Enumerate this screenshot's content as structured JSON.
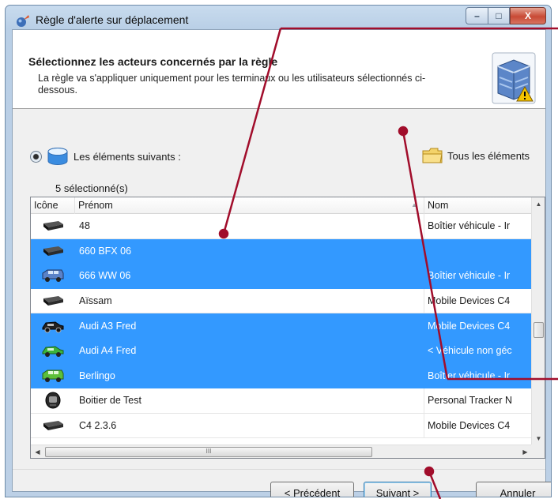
{
  "window": {
    "title": "Règle d'alerte sur déplacement",
    "controls": {
      "minimize": "–",
      "maximize": "□",
      "close": "X"
    }
  },
  "header": {
    "title": "Sélectionnez les acteurs concernés par la règle",
    "description": "La règle va s'appliquer uniquement pour les terminaux ou les utilisateurs sélectionnés ci-dessous.",
    "image_icon": "server-warning-icon"
  },
  "options": {
    "following": {
      "label": "Les éléments suivants :",
      "icon": "database-icon",
      "selected": true
    },
    "all": {
      "label": "Tous les éléments",
      "icon": "folder-icon",
      "selected": false
    }
  },
  "selected_count": "5 sélectionné(s)",
  "grid": {
    "columns": [
      "Icône",
      "Prénom",
      "Nom"
    ],
    "sort_indicator": "▲",
    "rows": [
      {
        "icon": "tracker-box-icon",
        "prenom": "48",
        "nom": "Boîtier véhicule - Ir",
        "selected": false
      },
      {
        "icon": "tracker-box-icon",
        "prenom": "660 BFX 06",
        "nom": "",
        "selected": true
      },
      {
        "icon": "van-icon",
        "prenom": "666 WW 06",
        "nom": "Boîtier véhicule - Ir",
        "selected": true
      },
      {
        "icon": "tracker-box-icon",
        "prenom": "Aïssam",
        "nom": "Mobile Devices C4",
        "selected": false
      },
      {
        "icon": "car-icon",
        "prenom": "Audi A3 Fred",
        "nom": "Mobile Devices C4",
        "selected": true
      },
      {
        "icon": "green-car-icon",
        "prenom": "Audi A4 Fred",
        "nom": "< Véhicule non géc",
        "selected": true
      },
      {
        "icon": "green-van-icon",
        "prenom": "Berlingo",
        "nom": "Boîtier véhicule - Ir",
        "selected": true
      },
      {
        "icon": "personal-tracker-icon",
        "prenom": "Boitier de Test",
        "nom": "Personal Tracker N",
        "selected": false
      },
      {
        "icon": "tracker-box-icon",
        "prenom": "C4 2.3.6",
        "nom": "Mobile Devices C4",
        "selected": false
      }
    ],
    "hscroll_grip": "III"
  },
  "buttons": {
    "previous": "< Précédent",
    "next": "Suivant >",
    "cancel": "Annuler"
  },
  "colors": {
    "selection": "#3399ff",
    "annotation": "#a10d2b"
  }
}
